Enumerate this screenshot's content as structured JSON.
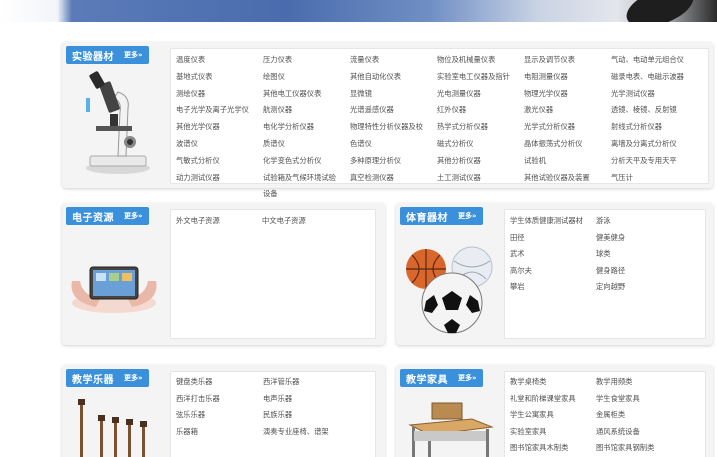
{
  "lab": {
    "title": "实验器材",
    "more": "更多»",
    "links": [
      [
        "温度仪表",
        "压力仪表",
        "流量仪表",
        "物位及机械量仪表",
        "显示及调节仪表",
        "气动、电动单元组合仪"
      ],
      [
        "基地式仪表",
        "绘图仪",
        "其他自动化仪表",
        "实验室电工仪器及指针",
        "电阻测量仪器",
        "磁录电表、电磁示波器"
      ],
      [
        "测绘仪器",
        "其他电工仪器仪表",
        "显微镜",
        "光电测量仪器",
        "物理光学仪器",
        "光学测试仪器"
      ],
      [
        "电子光学及离子光学仪",
        "航测仪器",
        "光谱遥感仪器",
        "红外仪器",
        "激光仪器",
        "透镜、棱镜、反射镜"
      ],
      [
        "其他光学仪器",
        "电化学分析仪器",
        "物理特性分析仪器及校",
        "热学式分析仪器",
        "光学式分析仪器",
        "射线式分析仪器"
      ],
      [
        "波谱仪",
        "质谱仪",
        "色谱仪",
        "磁式分析仪",
        "晶体振荡式分析仪",
        "离墙及分离式分析仪"
      ],
      [
        "气敏式分析仪",
        "化学变色式分析仪",
        "多种原理分析仪",
        "其他分析仪器",
        "试验机",
        "分析天平及专用天平"
      ],
      [
        "动力测试仪器",
        "试验箱及气候环境试验",
        "真空检测仪器",
        "土工测试仪器",
        "其他试验仪器及装置",
        "气压计"
      ],
      [
        "",
        "设备",
        "",
        "",
        "",
        ""
      ]
    ]
  },
  "electronic": {
    "title": "电子资源",
    "more": "更多»",
    "links": [
      "外文电子资源",
      "中文电子资源"
    ]
  },
  "sports": {
    "title": "体育器材",
    "more": "更多»",
    "links": [
      [
        "学生体质健康测试器材",
        "游泳"
      ],
      [
        "田径",
        "健美健身"
      ],
      [
        "武术",
        "球类"
      ],
      [
        "高尔夫",
        "健身路径"
      ],
      [
        "攀岩",
        "定向越野"
      ]
    ]
  },
  "music": {
    "title": "教学乐器",
    "more": "更多»",
    "links": [
      [
        "键盘类乐器",
        "西洋管乐器"
      ],
      [
        "西洋打击乐器",
        "电声乐器"
      ],
      [
        "弦乐乐器",
        "民族乐器"
      ],
      [
        "乐器箱",
        "演奏专业座椅、谱架"
      ]
    ]
  },
  "furniture": {
    "title": "教学家具",
    "more": "更多»",
    "links": [
      [
        "教学桌椅类",
        "教学用频类"
      ],
      [
        "礼堂和阶梯课堂家具",
        "学生食堂家具"
      ],
      [
        "学生公寓家具",
        "金属柜类"
      ],
      [
        "实验室家具",
        "通风系统设备"
      ],
      [
        "图书馆家具木制类",
        "图书馆家具钢制类"
      ]
    ]
  }
}
